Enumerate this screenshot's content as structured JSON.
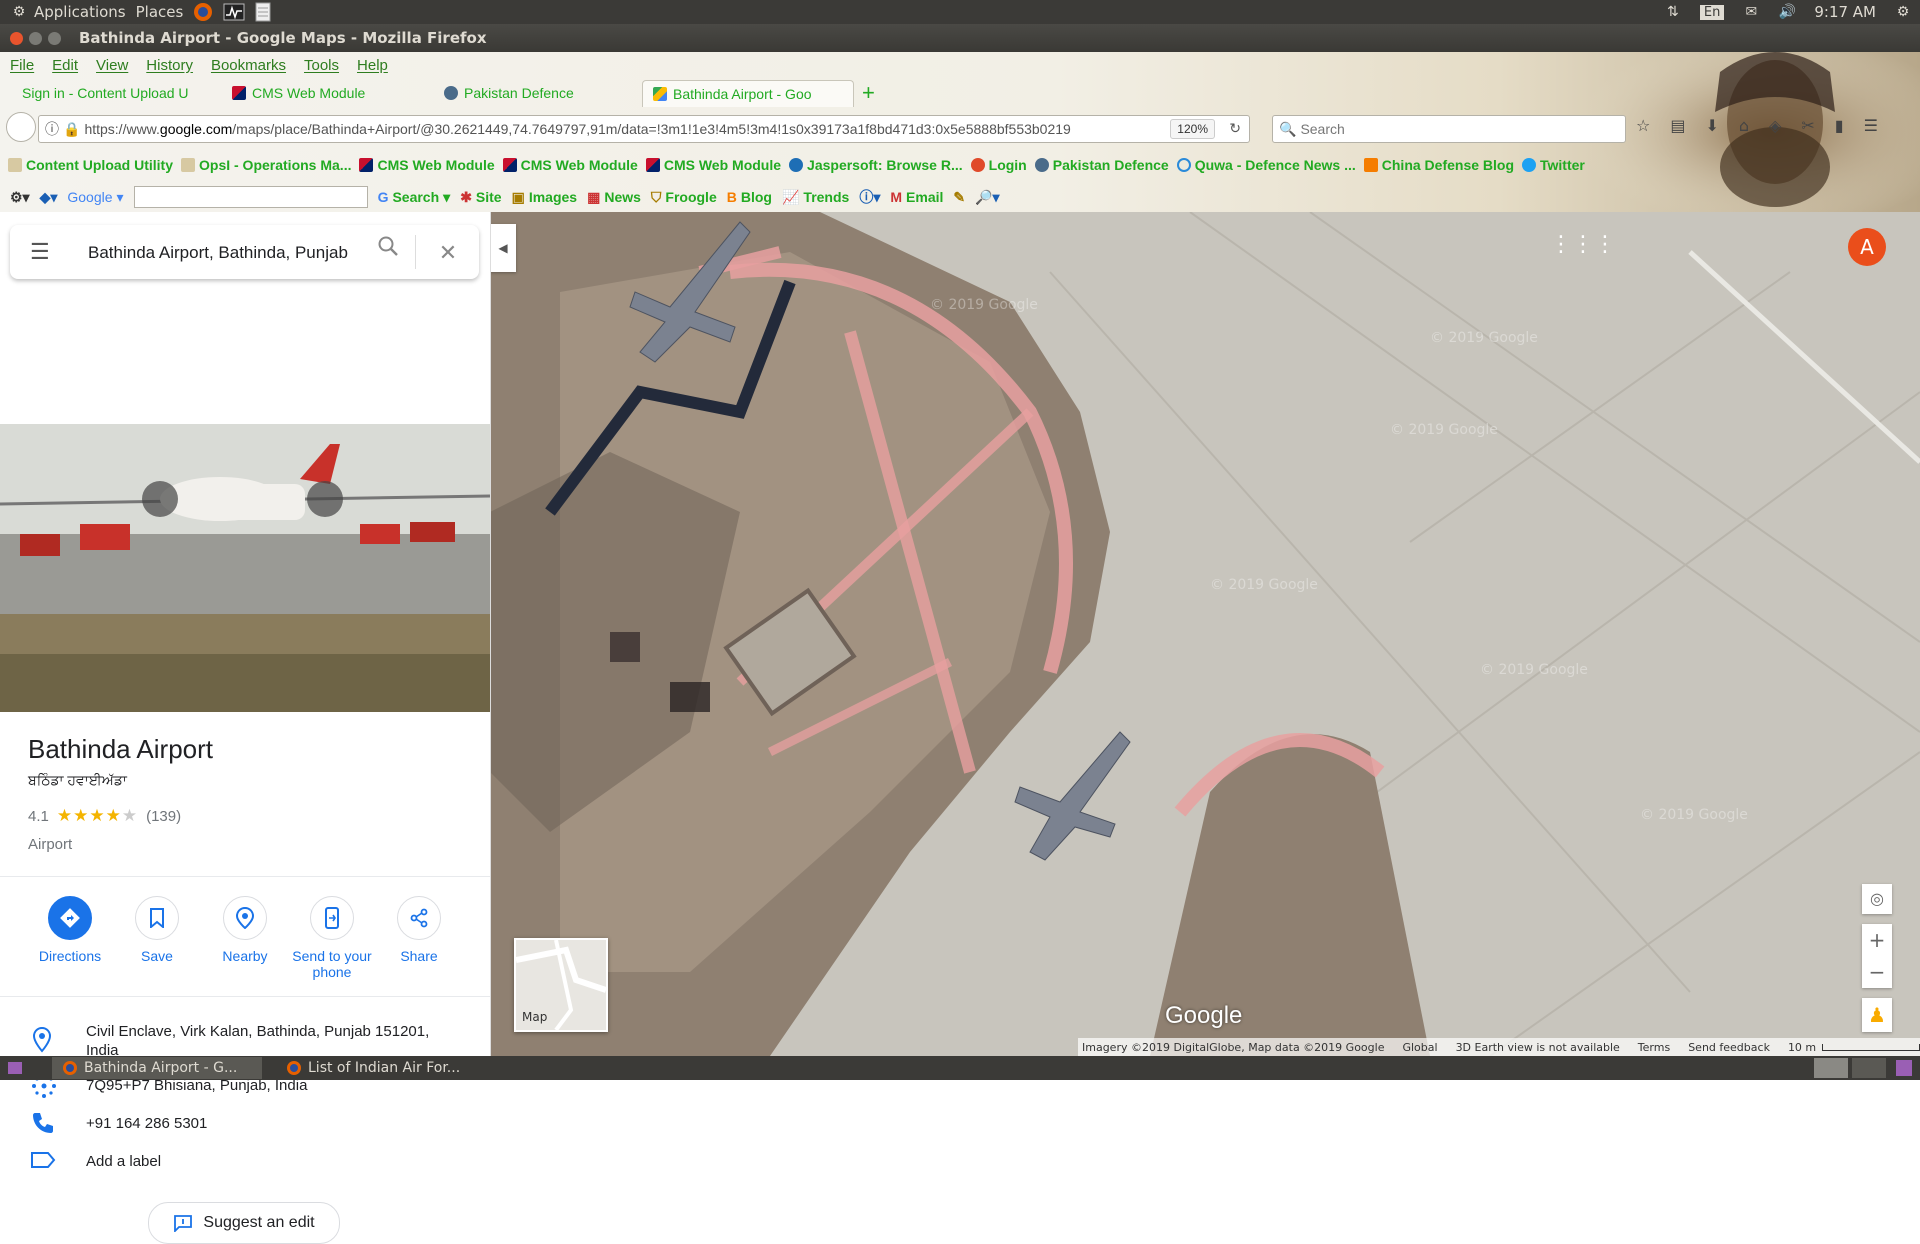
{
  "panel": {
    "applications": "Applications",
    "places": "Places",
    "lang": "En",
    "time": "9:17 AM"
  },
  "window": {
    "title": "Bathinda Airport - Google Maps - Mozilla Firefox"
  },
  "menu": [
    "File",
    "Edit",
    "View",
    "History",
    "Bookmarks",
    "Tools",
    "Help"
  ],
  "tabs": [
    {
      "label": "Sign in - Content Upload U"
    },
    {
      "label": "CMS Web Module"
    },
    {
      "label": "Pakistan Defence"
    },
    {
      "label": "Bathinda Airport - Goo"
    }
  ],
  "url": {
    "prefix": "https://www.",
    "domain": "google.com",
    "rest": "/maps/place/Bathinda+Airport/@30.2621449,74.7649797,91m/data=!3m1!1e3!4m5!3m4!1s0x39173a1f8bd471d3:0x5e5888bf553b0219",
    "zoom": "120%"
  },
  "search": {
    "placeholder": "Search"
  },
  "bookmarks": [
    "Content Upload Utility",
    "OpsI - Operations Ma...",
    "CMS Web Module",
    "CMS Web Module",
    "CMS Web Module",
    "Jaspersoft: Browse R...",
    "Login",
    "Pakistan Defence",
    "Quwa - Defence News ...",
    "China Defense Blog",
    "Twitter"
  ],
  "googlebar": {
    "brand": "Google",
    "items": [
      "Search",
      "Site",
      "Images",
      "News",
      "Froogle",
      "Blog",
      "Trends",
      "Email"
    ]
  },
  "maps": {
    "search_value": "Bathinda Airport, Bathinda, Punjab",
    "place_name": "Bathinda Airport",
    "place_native": "ਬਠਿੰਡਾ ਹਵਾਈਅੱਡਾ",
    "rating": "4.1",
    "rating_value": 4.1,
    "reviews": "(139)",
    "category": "Airport",
    "actions": [
      {
        "label": "Directions"
      },
      {
        "label": "Save"
      },
      {
        "label": "Nearby"
      },
      {
        "label": "Send to your phone"
      },
      {
        "label": "Share"
      }
    ],
    "address": "Civil Enclave, Virk Kalan, Bathinda, Punjab 151201, India",
    "plus_code": "7Q95+P7 Bhisiana, Punjab, India",
    "phone": "+91 164 286 5301",
    "add_label": "Add a label",
    "suggest_edit": "Suggest an edit",
    "avatar_letter": "A",
    "map_toggle": "Map",
    "google_logo": "Google",
    "watermark": "© 2019 Google",
    "attribution": {
      "imagery": "Imagery ©2019 DigitalGlobe, Map data ©2019 Google",
      "global": "Global",
      "earth": "3D Earth view is not available",
      "terms": "Terms",
      "feedback": "Send feedback",
      "scale": "10 m"
    }
  },
  "taskbar": [
    {
      "label": "Bathinda Airport - G..."
    },
    {
      "label": "List of Indian Air For..."
    }
  ]
}
